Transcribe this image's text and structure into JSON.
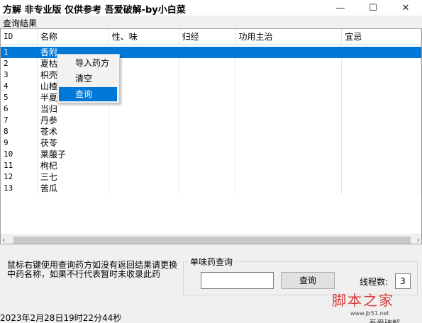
{
  "window": {
    "title": "方解 非专业版  仅供参考  吾爱破解-by小白菜",
    "minimize_glyph": "—",
    "maximize_glyph": "☐",
    "close_glyph": "✕"
  },
  "results_group": {
    "label": "查询结果"
  },
  "table": {
    "columns": [
      "ID",
      "名称",
      "性、味",
      "归经",
      "功用主治",
      "宜忌"
    ],
    "rows": [
      {
        "id": "1",
        "name": "香附"
      },
      {
        "id": "2",
        "name": "夏枯"
      },
      {
        "id": "3",
        "name": "枳壳"
      },
      {
        "id": "4",
        "name": "山楂"
      },
      {
        "id": "5",
        "name": "半夏"
      },
      {
        "id": "6",
        "name": "当归"
      },
      {
        "id": "7",
        "name": "丹参"
      },
      {
        "id": "8",
        "name": "苍术"
      },
      {
        "id": "9",
        "name": "茯苓"
      },
      {
        "id": "10",
        "name": "莱菔子"
      },
      {
        "id": "11",
        "name": "枸杞"
      },
      {
        "id": "12",
        "name": "三七"
      },
      {
        "id": "13",
        "name": "苦瓜"
      }
    ],
    "selected_row": "1"
  },
  "context_menu": {
    "items": [
      "导入药方",
      "清空",
      "查询"
    ],
    "highlighted": "查询"
  },
  "scrollbar": {
    "left_glyph": "‹",
    "right_glyph": "›"
  },
  "hint_text": "鼠标右键使用查询药方如没有返回结果请更换中药名称，如果不行代表暂时未收录此药",
  "single_herb": {
    "title": "单味药查询",
    "input_value": "",
    "query_button": "查询"
  },
  "threads": {
    "label": "线程数:",
    "value": "3"
  },
  "status": {
    "datetime": "2023年2月28日19时22分44秒"
  },
  "watermark": {
    "text": "脚本之家",
    "url": "www.jb51.net",
    "button": "吾爱破解"
  }
}
